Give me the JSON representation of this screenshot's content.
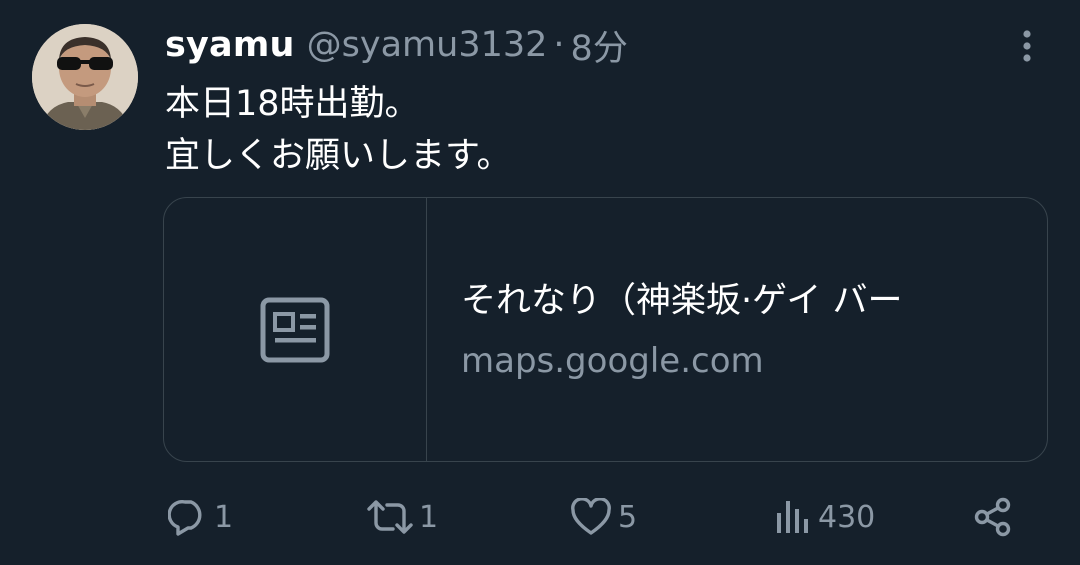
{
  "tweet": {
    "display_name": "syamu",
    "handle": "@syamu3132",
    "separator": "·",
    "time": "8分",
    "text_lines": [
      "本日18時出勤。",
      "宜しくお願いします。"
    ]
  },
  "card": {
    "title": "それなり（神楽坂·ゲイ バー",
    "domain": "maps.google.com",
    "media_icon": "article-icon"
  },
  "actions": {
    "reply_count": "1",
    "retweet_count": "1",
    "like_count": "5",
    "views_count": "430"
  },
  "icons": {
    "more": "more-vertical-icon",
    "reply": "reply-icon",
    "retweet": "retweet-icon",
    "like": "heart-icon",
    "views": "views-icon",
    "share": "share-icon"
  },
  "colors": {
    "background": "#15202b",
    "secondary_text": "#8b98a5",
    "border": "#38444d"
  }
}
